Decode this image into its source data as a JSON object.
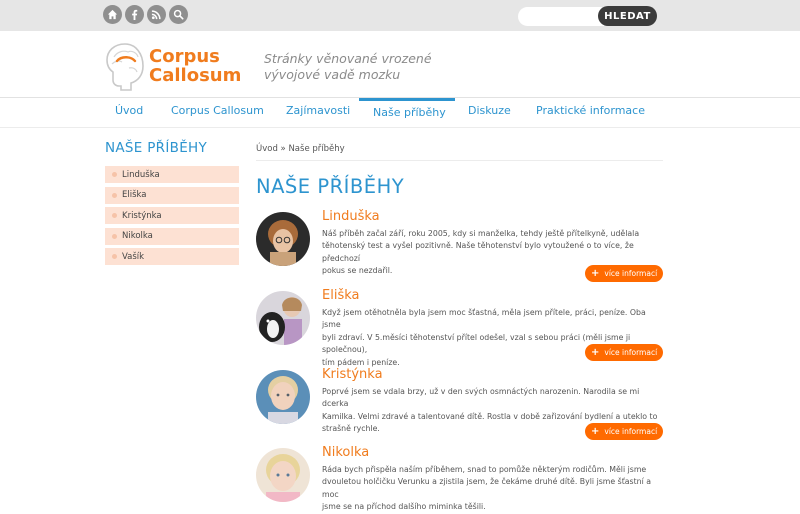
{
  "topbar": {
    "icons": [
      "home-icon",
      "facebook-icon",
      "rss-icon",
      "search-icon"
    ],
    "search_placeholder": "",
    "search_button": "HLEDAT"
  },
  "header": {
    "brand_line1": "Corpus",
    "brand_line2": "Callosum",
    "tagline_line1": "Stránky věnované vrozené",
    "tagline_line2": "vývojové vadě mozku"
  },
  "nav": {
    "items": [
      {
        "label": "Úvod"
      },
      {
        "label": "Corpus Callosum"
      },
      {
        "label": "Zajímavosti"
      },
      {
        "label": "Naše příběhy",
        "active": true
      },
      {
        "label": "Diskuze"
      },
      {
        "label": "Praktické informace"
      }
    ]
  },
  "sidebar": {
    "title": "NAŠE PŘÍBĚHY",
    "items": [
      "Linduška",
      "Eliška",
      "Kristýnka",
      "Nikolka",
      "Vašík"
    ]
  },
  "breadcrumb": "Úvod » Naše příběhy",
  "main": {
    "title": "NAŠE PŘÍBĚHY",
    "more_label": "více informací",
    "stories": [
      {
        "name": "Linduška",
        "lines": [
          "Náš příběh začal září, roku 2005, kdy si manželka, tehdy ještě přítelkyně, udělala",
          "těhotenský test a vyšel pozitivně. Naše těhotenství bylo vytoužené o to více, že předchozí",
          "pokus se nezdařil."
        ]
      },
      {
        "name": "Eliška",
        "lines": [
          "Když jsem otěhotněla byla jsem moc šťastná, měla jsem přítele, práci, peníze. Oba jsme",
          "byli zdraví. V 5.měsíci těhotenství přítel odešel, vzal s sebou práci (měli jsme ji společnou),",
          "tím pádem i peníze."
        ]
      },
      {
        "name": "Kristýnka",
        "lines": [
          "Poprvé jsem se vdala brzy, už v den svých osmnáctých narozenin. Narodila se mi dcerka",
          "Kamilka. Velmi zdravé a talentované dítě. Rostla v době zařizování bydlení a uteklo to",
          "strašně rychle."
        ]
      },
      {
        "name": "Nikolka",
        "lines": [
          "Ráda bych přispěla naším příběhem, snad to pomůže některým rodičům. Měli jsme",
          "dvouletou holčičku Verunku a zjistila jsem, že čekáme druhé dítě. Byli  jsme šťastní a moc",
          "jsme se na příchod dalšího miminka těšili."
        ]
      }
    ]
  }
}
